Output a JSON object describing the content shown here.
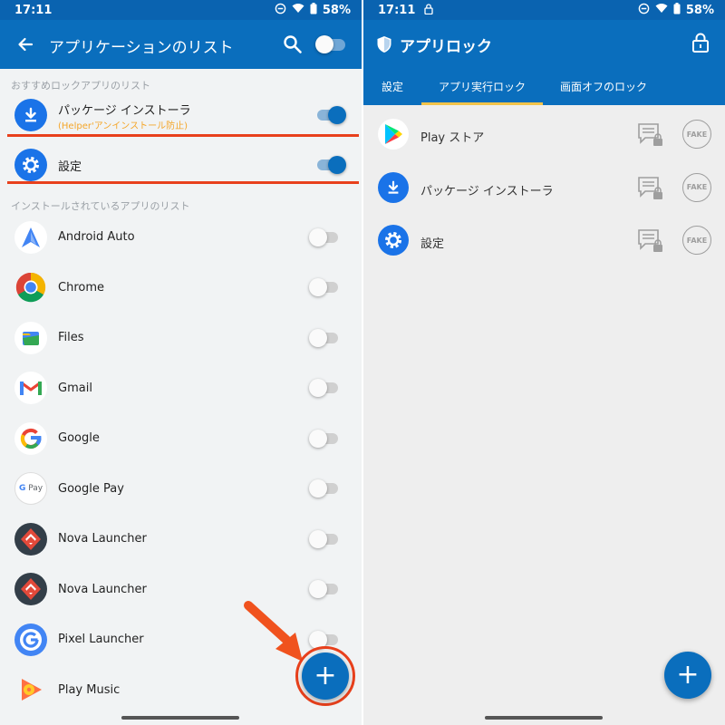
{
  "left": {
    "status": {
      "time": "17:11",
      "battery": "58%"
    },
    "title": "アプリケーションのリスト",
    "recommended_header": "おすすめロックアプリのリスト",
    "recommended": [
      {
        "name": "パッケージ インストーラ",
        "sub": "(Helper'アンインストール防止)",
        "on": true
      },
      {
        "name": "設定",
        "on": true
      }
    ],
    "installed_header": "インストールされているアプリのリスト",
    "installed": [
      {
        "name": "Android Auto"
      },
      {
        "name": "Chrome"
      },
      {
        "name": "Files"
      },
      {
        "name": "Gmail"
      },
      {
        "name": "Google"
      },
      {
        "name": "Google Pay"
      },
      {
        "name": "Nova Launcher"
      },
      {
        "name": "Nova Launcher"
      },
      {
        "name": "Pixel Launcher"
      },
      {
        "name": "Play Music"
      }
    ],
    "fab_label": "+",
    "colors": {
      "primary": "#0a6ebd",
      "highlight": "#e8401c",
      "subtext": "#f4a62a"
    }
  },
  "right": {
    "status": {
      "time": "17:11",
      "battery": "58%"
    },
    "title": "アプリロック",
    "tabs": [
      "設定",
      "アプリ実行ロック",
      "画面オフのロック"
    ],
    "apps": [
      {
        "name": "Play ストア",
        "fake": "FAKE"
      },
      {
        "name": "パッケージ インストーラ",
        "fake": "FAKE"
      },
      {
        "name": "設定",
        "fake": "FAKE"
      }
    ],
    "fab_label": "+"
  }
}
